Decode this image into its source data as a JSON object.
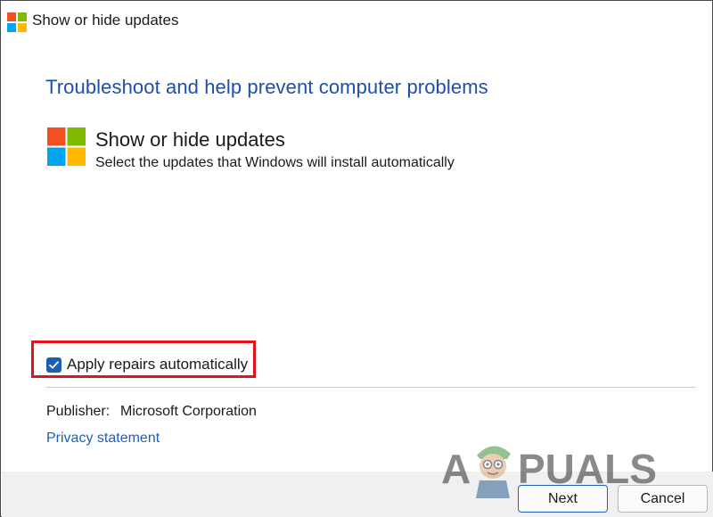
{
  "window": {
    "title": "Show or hide updates"
  },
  "main": {
    "heading": "Troubleshoot and help prevent computer problems",
    "tool_title": "Show or hide updates",
    "tool_description": "Select the updates that Windows will install automatically"
  },
  "options": {
    "apply_repairs_label": "Apply repairs automatically",
    "apply_repairs_checked": true
  },
  "publisher": {
    "label": "Publisher:",
    "value": "Microsoft Corporation"
  },
  "links": {
    "privacy": "Privacy statement"
  },
  "buttons": {
    "next": "Next",
    "cancel": "Cancel"
  },
  "watermark": {
    "left": "A",
    "right": "PUALS"
  },
  "colors": {
    "accent": "#1f4fa8",
    "highlight": "#e3121b",
    "logo_red": "#f25022",
    "logo_green": "#7fba00",
    "logo_blue": "#00a4ef",
    "logo_yellow": "#ffb900"
  }
}
